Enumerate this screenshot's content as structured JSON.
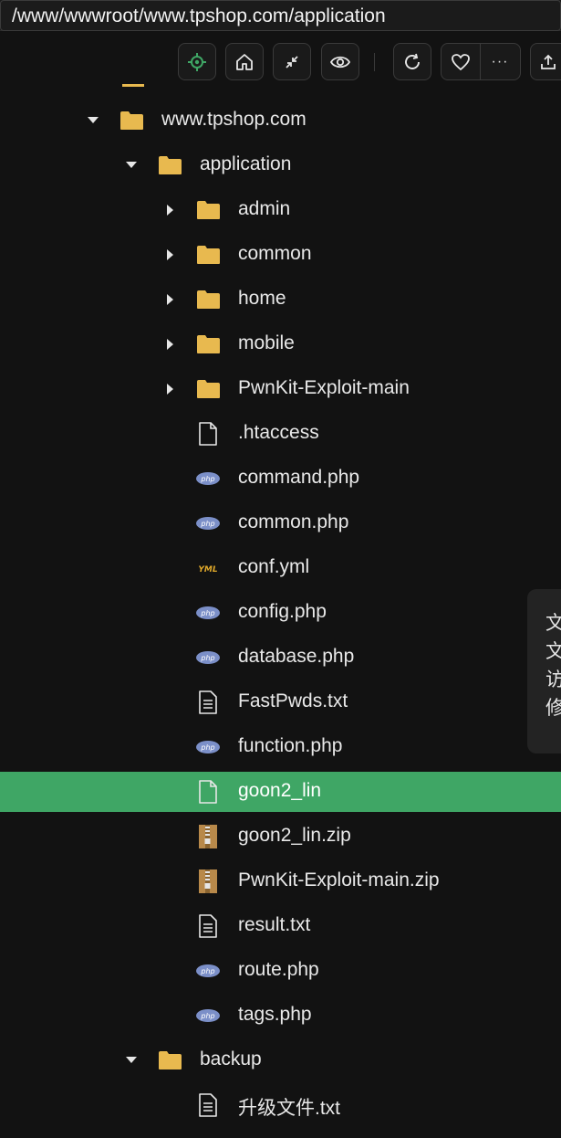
{
  "path": {
    "value": "/www/wwwroot/www.tpshop.com/application"
  },
  "toolbar": {
    "buttons": [
      {
        "name": "locate",
        "icon": "crosshair-icon",
        "color": "#3fa665"
      },
      {
        "name": "home",
        "icon": "home-icon"
      },
      {
        "name": "collapse",
        "icon": "collapse-icon"
      },
      {
        "name": "view",
        "icon": "eye-icon"
      },
      {
        "name": "refresh",
        "icon": "refresh-icon"
      },
      {
        "name": "favorite",
        "icon": "heart-icon"
      },
      {
        "name": "more",
        "icon": "more-icon",
        "glyph": "···"
      },
      {
        "name": "upload",
        "icon": "upload-icon"
      }
    ]
  },
  "tree": {
    "rows": [
      {
        "label": "www.tpshop.com",
        "type": "folder",
        "depth": 0,
        "state": "expanded"
      },
      {
        "label": "application",
        "type": "folder",
        "depth": 1,
        "state": "expanded"
      },
      {
        "label": "admin",
        "type": "folder",
        "depth": 2,
        "state": "collapsed"
      },
      {
        "label": "common",
        "type": "folder",
        "depth": 2,
        "state": "collapsed"
      },
      {
        "label": "home",
        "type": "folder",
        "depth": 2,
        "state": "collapsed"
      },
      {
        "label": "mobile",
        "type": "folder",
        "depth": 2,
        "state": "collapsed"
      },
      {
        "label": "PwnKit-Exploit-main",
        "type": "folder",
        "depth": 2,
        "state": "collapsed"
      },
      {
        "label": ".htaccess",
        "type": "file",
        "depth": 2
      },
      {
        "label": "command.php",
        "type": "php",
        "depth": 2
      },
      {
        "label": "common.php",
        "type": "php",
        "depth": 2
      },
      {
        "label": "conf.yml",
        "type": "yml",
        "depth": 2
      },
      {
        "label": "config.php",
        "type": "php",
        "depth": 2
      },
      {
        "label": "database.php",
        "type": "php",
        "depth": 2
      },
      {
        "label": "FastPwds.txt",
        "type": "txt",
        "depth": 2
      },
      {
        "label": "function.php",
        "type": "php",
        "depth": 2
      },
      {
        "label": "goon2_lin",
        "type": "file",
        "depth": 2,
        "selected": true
      },
      {
        "label": "goon2_lin.zip",
        "type": "zip",
        "depth": 2
      },
      {
        "label": "PwnKit-Exploit-main.zip",
        "type": "zip",
        "depth": 2
      },
      {
        "label": "result.txt",
        "type": "txt",
        "depth": 2
      },
      {
        "label": "route.php",
        "type": "php",
        "depth": 2
      },
      {
        "label": "tags.php",
        "type": "php",
        "depth": 2
      },
      {
        "label": "backup",
        "type": "folder",
        "depth": 1,
        "state": "expanded"
      },
      {
        "label": "升级文件.txt",
        "type": "txt",
        "depth": 2
      }
    ],
    "php_badge": "php",
    "yml_badge": "YML"
  },
  "tooltip": {
    "lines": [
      "文",
      "文",
      "访",
      "修"
    ]
  },
  "colors": {
    "background": "#121212",
    "selected": "#3fa665",
    "folder": "#e8b94f",
    "php": "#7b8fc8",
    "yml": "#e0a92a",
    "zip": "#b8894a"
  }
}
